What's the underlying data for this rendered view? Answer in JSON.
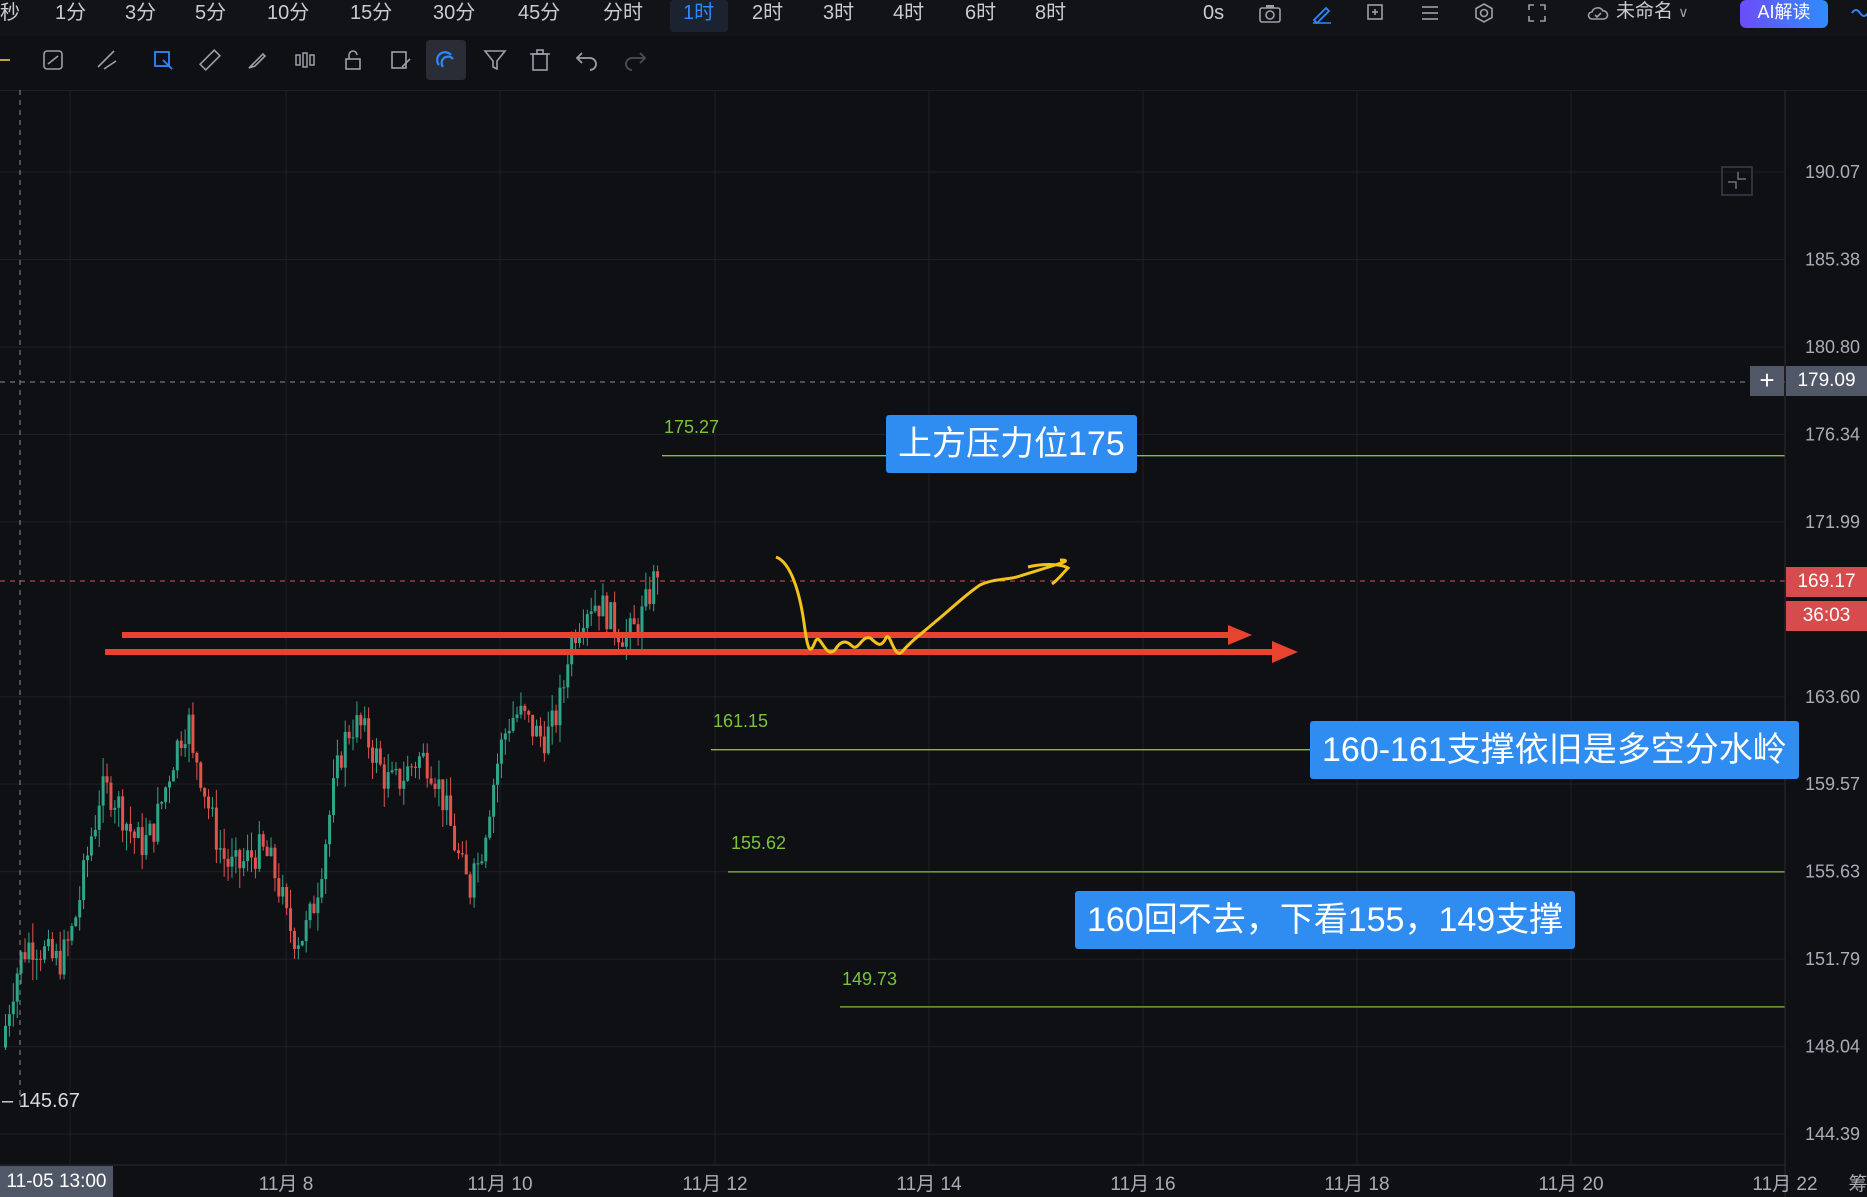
{
  "toolbar": {
    "timeframes": [
      "秒",
      "1分",
      "3分",
      "5分",
      "10分",
      "15分",
      "30分",
      "45分",
      "分时",
      "1时",
      "2时",
      "3时",
      "4时",
      "6时",
      "8时"
    ],
    "active_timeframe": "1时",
    "countdown": "0s",
    "layout_name": "未命名",
    "ai_button": "AI解读"
  },
  "drawing_tools": [
    "cursor-mode",
    "auto-draw",
    "trend-lines",
    "select-shape",
    "ruler",
    "brush",
    "candle-pattern",
    "lock",
    "edit-notes",
    "magnet",
    "filter",
    "delete",
    "undo",
    "redo"
  ],
  "colors": {
    "background": "#0f1014",
    "grid": "#1e2128",
    "up_candle": "#2fa489",
    "down_candle": "#e2524f",
    "level_line": "#7cc33a",
    "callout": "#2f8cf0",
    "annotation_arrow": "#e8432e",
    "annotation_curve": "#f3c21b",
    "current_price_tag": "#d64b4b",
    "crosshair_tag": "#505766"
  },
  "price_axis": {
    "ticks": [
      "190.07",
      "185.38",
      "180.80",
      "176.34",
      "171.99",
      "163.60",
      "159.57",
      "155.63",
      "151.79",
      "148.04",
      "144.39"
    ],
    "crosshair_price": "179.09",
    "current_price": "169.17",
    "bar_countdown": "36:03",
    "low_marker": "145.67"
  },
  "time_axis": {
    "crosshair_date": "11-05 13:00",
    "ticks": [
      "11月 8",
      "11月 10",
      "11月 12",
      "11月 14",
      "11月 16",
      "11月 18",
      "11月 20",
      "11月 22"
    ],
    "edge_text": "筹"
  },
  "levels": [
    {
      "label": "175.27",
      "price": 175.27
    },
    {
      "label": "161.15",
      "price": 161.15
    },
    {
      "label": "155.62",
      "price": 155.62
    },
    {
      "label": "149.73",
      "price": 149.73
    }
  ],
  "callouts": {
    "resistance": "上方压力位175",
    "support_pivot": "160-161支撑依旧是多空分水岭",
    "breakdown": "160回不去，下看155，149支撑"
  },
  "chart_data": {
    "type": "candlestick",
    "interval": "1h",
    "x_range": [
      "11-05 13:00",
      "11-22"
    ],
    "y_range": [
      144.39,
      190.07
    ],
    "grid": true,
    "series": [
      {
        "time": "11-05",
        "open": 148.0,
        "high": 157.5,
        "low": 146.5,
        "close": 157.0
      },
      {
        "time": "11-06",
        "open": 157.0,
        "high": 164.5,
        "low": 154.0,
        "close": 160.5
      },
      {
        "time": "11-07",
        "open": 160.5,
        "high": 161.0,
        "low": 152.0,
        "close": 153.5
      },
      {
        "time": "11-08",
        "open": 153.5,
        "high": 164.5,
        "low": 150.5,
        "close": 162.0
      },
      {
        "time": "11-09",
        "open": 162.0,
        "high": 162.5,
        "low": 153.5,
        "close": 156.5
      },
      {
        "time": "11-10",
        "open": 156.5,
        "high": 168.0,
        "low": 156.0,
        "close": 165.5
      },
      {
        "time": "11-11",
        "open": 165.5,
        "high": 171.9,
        "low": 163.5,
        "close": 169.17
      }
    ]
  }
}
